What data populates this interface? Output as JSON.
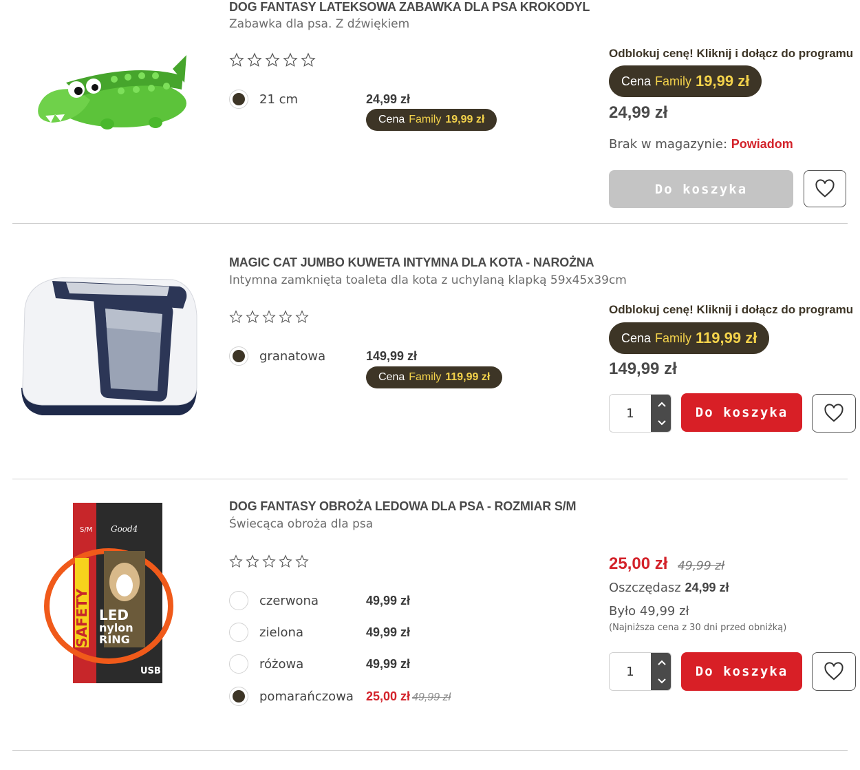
{
  "products": [
    {
      "title": "DOG FANTASY LATEKSOWA ZABAWKA DLA PSA KROKODYL",
      "subtitle": "Zabawka dla psa. Z dźwiękiem",
      "image_icon": "crocodile-toy-image",
      "variants": [
        {
          "label": "21 cm",
          "price": "24,99 zł",
          "selected": true,
          "family_label": "Cena",
          "family_word": "Family",
          "family_price": "19,99 zł"
        }
      ],
      "promo_text": "Odblokuj cenę! Kliknij i dołącz do programu",
      "family_label": "Cena",
      "family_word": "Family",
      "family_price": "19,99 zł",
      "price": "24,99 zł",
      "stock_text": "Brak w magazynie:",
      "notify_link": "Powiadom",
      "cart_button": "Do koszyka",
      "cart_enabled": false
    },
    {
      "title": "MAGIC CAT JUMBO KUWETA INTYMNA DLA KOTA - NAROŻNA",
      "subtitle": "Intymna zamknięta toaleta dla kota z uchylaną klapką 59x45x39cm",
      "image_icon": "cat-litter-box-image",
      "variants": [
        {
          "label": "granatowa",
          "price": "149,99 zł",
          "selected": true,
          "family_label": "Cena",
          "family_word": "Family",
          "family_price": "119,99 zł"
        }
      ],
      "promo_text": "Odblokuj cenę! Kliknij i dołącz do programu",
      "family_label": "Cena",
      "family_word": "Family",
      "family_price": "119,99 zł",
      "price": "149,99 zł",
      "quantity": "1",
      "cart_button": "Do koszyka",
      "cart_enabled": true
    },
    {
      "title": "DOG FANTASY OBROŻA LEDOWA DLA PSA - ROZMIAR S/M",
      "subtitle": "Świecąca obroża dla psa",
      "image_icon": "led-dog-collar-package-image",
      "packaging_text": {
        "size": "S/M",
        "brand": "Good4",
        "safety": "SAFETY",
        "led": "LED",
        "nylon": "nylon",
        "ring": "RING",
        "usb": "USB"
      },
      "variants": [
        {
          "label": "czerwona",
          "price": "49,99 zł",
          "selected": false
        },
        {
          "label": "zielona",
          "price": "49,99 zł",
          "selected": false
        },
        {
          "label": "różowa",
          "price": "49,99 zł",
          "selected": false
        },
        {
          "label": "pomarańczowa",
          "price": "25,00 zł",
          "old_price": "49,99 zł",
          "selected": true
        }
      ],
      "sale_price": "25,00 zł",
      "old_price": "49,99 zł",
      "save_label": "Oszczędasz",
      "save_amount": "24,99 zł",
      "was_text": "Było 49,99 zł",
      "lowest_note": "(Najniższa cena z 30 dni przed obniżką)",
      "quantity": "1",
      "cart_button": "Do koszyka",
      "cart_enabled": true
    }
  ],
  "colors": {
    "accent_red": "#d81f26",
    "family_dark": "#3d3526",
    "family_yellow": "#f3d24b",
    "disabled_gray": "#c4c4c4"
  },
  "icons": {
    "rating": "star-outline-icon",
    "wishlist": "heart-outline-icon",
    "qty_up": "chevron-up-icon",
    "qty_down": "chevron-down-icon"
  }
}
